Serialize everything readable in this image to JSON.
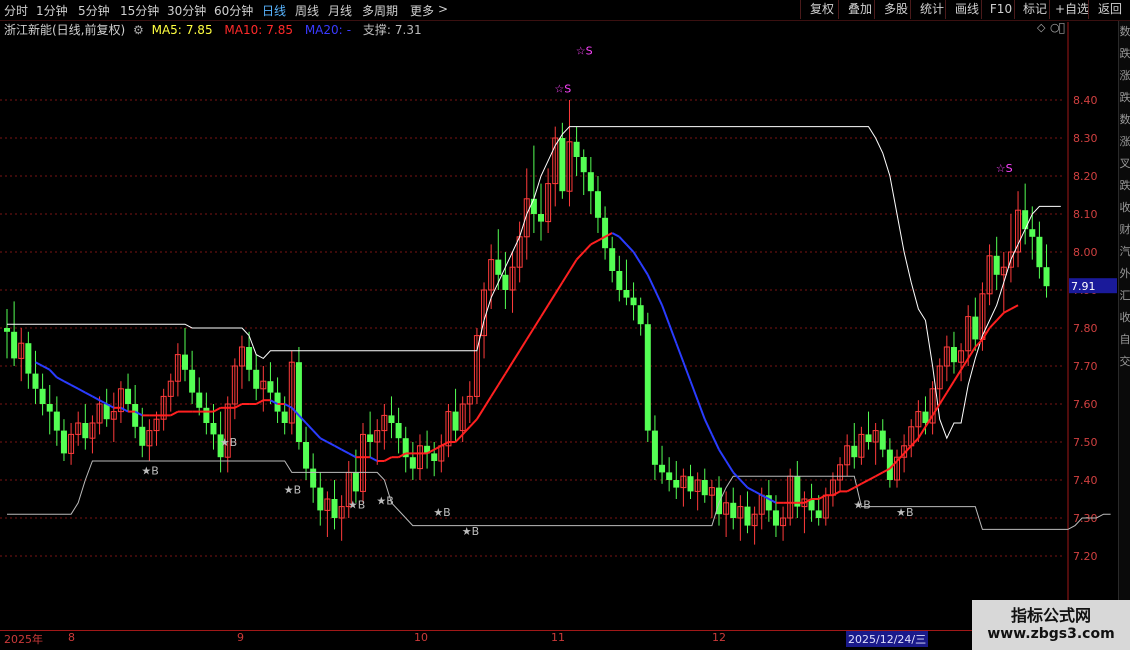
{
  "toolbar": {
    "periods": [
      "分时",
      "1分钟",
      "5分钟",
      "15分钟",
      "30分钟",
      "60分钟",
      "日线",
      "周线",
      "月线",
      "多周期",
      "更多"
    ],
    "active_period": "日线",
    "more_arrow": ">",
    "right_buttons": [
      "复权",
      "叠加",
      "多股",
      "统计",
      "画线",
      "F10",
      "标记",
      "+自选",
      "返回"
    ]
  },
  "info": {
    "stock_name": "浙江新能(日线,前复权)",
    "ma5_label": "MA5:",
    "ma5_value": "7.85",
    "ma10_label": "MA10:",
    "ma10_value": "7.85",
    "ma20_label": "MA20:",
    "ma20_value": "-",
    "support_label": "支撑:",
    "support_value": "7.31",
    "colors": {
      "ma5": "#ffff40",
      "ma10": "#ff2a2a",
      "ma20": "#3a3aff",
      "support": "#bbbbbb"
    }
  },
  "price_axis": {
    "ticks": [
      "8.40",
      "8.30",
      "8.20",
      "8.10",
      "8.00",
      "7.90",
      "7.80",
      "7.70",
      "7.60",
      "7.50",
      "7.40",
      "7.30",
      "7.20"
    ],
    "current_price": "7.91"
  },
  "date_axis": {
    "labels": [
      "2025年",
      "8",
      "9",
      "10",
      "11",
      "12"
    ],
    "cursor_date": "2025/12/24/三"
  },
  "watermark": {
    "line1": "指标公式网",
    "line2": "www.zbgs3.com"
  },
  "right_strip_chars": [
    "数",
    "跌",
    "涨",
    "跌",
    "数",
    "涨",
    "叉",
    "跌",
    "收",
    "财",
    "汽",
    "外",
    "汇",
    "收",
    "自",
    "交"
  ],
  "chart_data": {
    "type": "candlestick",
    "ylim": [
      7.15,
      8.58
    ],
    "signal_colors": {
      "buy": "#bdbdbd",
      "sell": "#ff44ff"
    },
    "candles": [
      [
        7.8,
        7.85,
        7.72,
        7.79
      ],
      [
        7.79,
        7.87,
        7.7,
        7.72
      ],
      [
        7.72,
        7.8,
        7.66,
        7.76
      ],
      [
        7.76,
        7.79,
        7.64,
        7.68
      ],
      [
        7.68,
        7.74,
        7.6,
        7.64
      ],
      [
        7.64,
        7.68,
        7.57,
        7.6
      ],
      [
        7.6,
        7.65,
        7.52,
        7.58
      ],
      [
        7.58,
        7.62,
        7.49,
        7.53
      ],
      [
        7.53,
        7.56,
        7.45,
        7.47
      ],
      [
        7.47,
        7.55,
        7.44,
        7.52
      ],
      [
        7.52,
        7.58,
        7.49,
        7.55
      ],
      [
        7.55,
        7.6,
        7.48,
        7.51
      ],
      [
        7.51,
        7.57,
        7.47,
        7.55
      ],
      [
        7.55,
        7.62,
        7.52,
        7.6
      ],
      [
        7.6,
        7.64,
        7.54,
        7.56
      ],
      [
        7.56,
        7.63,
        7.5,
        7.58
      ],
      [
        7.58,
        7.66,
        7.55,
        7.64
      ],
      [
        7.64,
        7.68,
        7.58,
        7.6
      ],
      [
        7.6,
        7.65,
        7.51,
        7.54
      ],
      [
        7.54,
        7.59,
        7.46,
        7.49
      ],
      [
        7.49,
        7.56,
        7.45,
        7.53
      ],
      [
        7.53,
        7.58,
        7.49,
        7.56
      ],
      [
        7.56,
        7.64,
        7.53,
        7.62
      ],
      [
        7.62,
        7.68,
        7.58,
        7.66
      ],
      [
        7.66,
        7.76,
        7.62,
        7.73
      ],
      [
        7.73,
        7.8,
        7.66,
        7.69
      ],
      [
        7.69,
        7.74,
        7.6,
        7.63
      ],
      [
        7.63,
        7.67,
        7.57,
        7.59
      ],
      [
        7.59,
        7.63,
        7.52,
        7.55
      ],
      [
        7.55,
        7.6,
        7.48,
        7.52
      ],
      [
        7.52,
        7.58,
        7.42,
        7.46
      ],
      [
        7.46,
        7.62,
        7.42,
        7.6
      ],
      [
        7.6,
        7.72,
        7.56,
        7.7
      ],
      [
        7.7,
        7.78,
        7.64,
        7.75
      ],
      [
        7.75,
        7.79,
        7.66,
        7.69
      ],
      [
        7.69,
        7.73,
        7.61,
        7.64
      ],
      [
        7.64,
        7.7,
        7.58,
        7.66
      ],
      [
        7.66,
        7.71,
        7.6,
        7.63
      ],
      [
        7.63,
        7.67,
        7.55,
        7.58
      ],
      [
        7.58,
        7.62,
        7.52,
        7.55
      ],
      [
        7.55,
        7.74,
        7.52,
        7.71
      ],
      [
        7.71,
        7.75,
        7.48,
        7.5
      ],
      [
        7.5,
        7.54,
        7.4,
        7.43
      ],
      [
        7.43,
        7.47,
        7.34,
        7.38
      ],
      [
        7.38,
        7.42,
        7.28,
        7.32
      ],
      [
        7.32,
        7.37,
        7.25,
        7.35
      ],
      [
        7.35,
        7.4,
        7.27,
        7.3
      ],
      [
        7.3,
        7.36,
        7.24,
        7.33
      ],
      [
        7.33,
        7.45,
        7.3,
        7.42
      ],
      [
        7.42,
        7.48,
        7.34,
        7.37
      ],
      [
        7.37,
        7.55,
        7.34,
        7.52
      ],
      [
        7.52,
        7.58,
        7.46,
        7.5
      ],
      [
        7.5,
        7.56,
        7.44,
        7.53
      ],
      [
        7.53,
        7.6,
        7.48,
        7.57
      ],
      [
        7.57,
        7.62,
        7.51,
        7.55
      ],
      [
        7.55,
        7.59,
        7.47,
        7.51
      ],
      [
        7.51,
        7.54,
        7.42,
        7.46
      ],
      [
        7.46,
        7.5,
        7.4,
        7.43
      ],
      [
        7.43,
        7.52,
        7.4,
        7.49
      ],
      [
        7.49,
        7.53,
        7.43,
        7.47
      ],
      [
        7.47,
        7.5,
        7.41,
        7.45
      ],
      [
        7.45,
        7.52,
        7.42,
        7.49
      ],
      [
        7.49,
        7.6,
        7.46,
        7.58
      ],
      [
        7.58,
        7.64,
        7.5,
        7.53
      ],
      [
        7.53,
        7.62,
        7.5,
        7.6
      ],
      [
        7.6,
        7.66,
        7.55,
        7.62
      ],
      [
        7.62,
        7.8,
        7.6,
        7.78
      ],
      [
        7.78,
        7.92,
        7.72,
        7.9
      ],
      [
        7.9,
        8.02,
        7.85,
        7.98
      ],
      [
        7.98,
        8.06,
        7.9,
        7.94
      ],
      [
        7.94,
        8.0,
        7.85,
        7.9
      ],
      [
        7.9,
        8.0,
        7.84,
        7.96
      ],
      [
        7.96,
        8.08,
        7.92,
        8.04
      ],
      [
        8.04,
        8.22,
        7.98,
        8.14
      ],
      [
        8.14,
        8.28,
        8.05,
        8.1
      ],
      [
        8.1,
        8.18,
        8.03,
        8.08
      ],
      [
        8.08,
        8.22,
        8.05,
        8.18
      ],
      [
        8.18,
        8.33,
        8.12,
        8.3
      ],
      [
        8.3,
        8.34,
        8.14,
        8.16
      ],
      [
        8.16,
        8.4,
        8.12,
        8.29
      ],
      [
        8.29,
        8.33,
        8.2,
        8.25
      ],
      [
        8.25,
        8.27,
        8.15,
        8.21
      ],
      [
        8.21,
        8.25,
        8.1,
        8.16
      ],
      [
        8.16,
        8.2,
        8.05,
        8.09
      ],
      [
        8.09,
        8.12,
        7.98,
        8.01
      ],
      [
        8.01,
        8.04,
        7.92,
        7.95
      ],
      [
        7.95,
        7.99,
        7.87,
        7.9
      ],
      [
        7.9,
        7.98,
        7.86,
        7.88
      ],
      [
        7.88,
        7.92,
        7.82,
        7.86
      ],
      [
        7.86,
        7.88,
        7.78,
        7.81
      ],
      [
        7.81,
        7.84,
        7.5,
        7.53
      ],
      [
        7.53,
        7.57,
        7.4,
        7.44
      ],
      [
        7.44,
        7.49,
        7.39,
        7.42
      ],
      [
        7.42,
        7.46,
        7.37,
        7.4
      ],
      [
        7.4,
        7.45,
        7.35,
        7.38
      ],
      [
        7.38,
        7.43,
        7.33,
        7.41
      ],
      [
        7.41,
        7.44,
        7.35,
        7.37
      ],
      [
        7.37,
        7.42,
        7.32,
        7.4
      ],
      [
        7.4,
        7.43,
        7.34,
        7.36
      ],
      [
        7.36,
        7.4,
        7.3,
        7.38
      ],
      [
        7.38,
        7.41,
        7.28,
        7.31
      ],
      [
        7.31,
        7.37,
        7.25,
        7.34
      ],
      [
        7.34,
        7.38,
        7.27,
        7.3
      ],
      [
        7.3,
        7.36,
        7.24,
        7.33
      ],
      [
        7.33,
        7.37,
        7.26,
        7.28
      ],
      [
        7.28,
        7.33,
        7.23,
        7.31
      ],
      [
        7.31,
        7.38,
        7.27,
        7.36
      ],
      [
        7.36,
        7.4,
        7.29,
        7.32
      ],
      [
        7.32,
        7.36,
        7.25,
        7.28
      ],
      [
        7.28,
        7.33,
        7.24,
        7.3
      ],
      [
        7.3,
        7.43,
        7.28,
        7.41
      ],
      [
        7.41,
        7.45,
        7.3,
        7.33
      ],
      [
        7.33,
        7.37,
        7.26,
        7.35
      ],
      [
        7.35,
        7.39,
        7.29,
        7.32
      ],
      [
        7.32,
        7.36,
        7.28,
        7.3
      ],
      [
        7.3,
        7.38,
        7.28,
        7.36
      ],
      [
        7.36,
        7.42,
        7.33,
        7.4
      ],
      [
        7.4,
        7.46,
        7.37,
        7.44
      ],
      [
        7.44,
        7.52,
        7.41,
        7.49
      ],
      [
        7.49,
        7.55,
        7.43,
        7.46
      ],
      [
        7.46,
        7.54,
        7.44,
        7.52
      ],
      [
        7.52,
        7.58,
        7.48,
        7.5
      ],
      [
        7.5,
        7.55,
        7.44,
        7.53
      ],
      [
        7.53,
        7.56,
        7.46,
        7.48
      ],
      [
        7.48,
        7.51,
        7.38,
        7.4
      ],
      [
        7.4,
        7.48,
        7.38,
        7.46
      ],
      [
        7.46,
        7.52,
        7.42,
        7.49
      ],
      [
        7.49,
        7.56,
        7.46,
        7.54
      ],
      [
        7.54,
        7.61,
        7.5,
        7.58
      ],
      [
        7.58,
        7.62,
        7.52,
        7.55
      ],
      [
        7.55,
        7.66,
        7.52,
        7.64
      ],
      [
        7.64,
        7.72,
        7.6,
        7.7
      ],
      [
        7.7,
        7.78,
        7.66,
        7.75
      ],
      [
        7.75,
        7.79,
        7.68,
        7.71
      ],
      [
        7.71,
        7.76,
        7.66,
        7.74
      ],
      [
        7.74,
        7.86,
        7.7,
        7.83
      ],
      [
        7.83,
        7.88,
        7.74,
        7.77
      ],
      [
        7.77,
        7.92,
        7.74,
        7.89
      ],
      [
        7.89,
        8.02,
        7.86,
        7.99
      ],
      [
        7.99,
        8.04,
        7.9,
        7.94
      ],
      [
        7.94,
        8.0,
        7.84,
        7.96
      ],
      [
        7.96,
        8.1,
        7.92,
        8.0
      ],
      [
        8.0,
        8.16,
        7.96,
        8.11
      ],
      [
        8.11,
        8.18,
        8.02,
        8.06
      ],
      [
        8.06,
        8.12,
        7.98,
        8.04
      ],
      [
        8.04,
        8.08,
        7.93,
        7.96
      ],
      [
        7.96,
        8.02,
        7.88,
        7.91
      ]
    ],
    "ma20": [
      null,
      null,
      null,
      null,
      7.71,
      7.7,
      7.69,
      7.67,
      7.66,
      7.65,
      7.64,
      7.63,
      7.62,
      7.61,
      7.6,
      7.59,
      7.59,
      7.58,
      7.58,
      7.57,
      7.57,
      7.57,
      7.57,
      7.57,
      7.58,
      7.58,
      7.58,
      7.58,
      7.58,
      7.58,
      7.59,
      7.59,
      7.59,
      7.6,
      7.6,
      7.6,
      7.61,
      7.61,
      7.6,
      7.6,
      7.59,
      7.57,
      7.55,
      7.53,
      7.51,
      7.5,
      7.49,
      7.48,
      7.47,
      7.46,
      7.46,
      7.46,
      7.45,
      7.45,
      7.46,
      7.46,
      7.47,
      7.47,
      7.47,
      7.47,
      7.48,
      7.49,
      7.5,
      7.5,
      7.52,
      7.54,
      7.56,
      7.59,
      7.62,
      7.65,
      7.68,
      7.71,
      7.74,
      7.77,
      7.8,
      7.83,
      7.86,
      7.89,
      7.92,
      7.95,
      7.98,
      8.0,
      8.02,
      8.03,
      8.04,
      8.05,
      8.04,
      8.02,
      8.0,
      7.97,
      7.94,
      7.9,
      7.86,
      7.81,
      7.76,
      7.71,
      7.66,
      7.61,
      7.56,
      7.52,
      7.48,
      7.45,
      7.42,
      7.4,
      7.38,
      7.37,
      7.36,
      7.35,
      7.34,
      7.34,
      7.34,
      7.34,
      7.34,
      7.35,
      7.35,
      7.36,
      7.36,
      7.37,
      7.37,
      7.38,
      7.39,
      7.4,
      7.41,
      7.42,
      7.43,
      7.45,
      7.47,
      7.49,
      7.51,
      7.54,
      7.57,
      7.6,
      7.63,
      7.66,
      7.69,
      7.72,
      7.75,
      7.77,
      7.8,
      7.82,
      7.84,
      7.85,
      7.86
    ],
    "upper_band": [
      7.81,
      7.81,
      7.81,
      7.81,
      7.81,
      7.81,
      7.81,
      7.81,
      7.81,
      7.81,
      7.81,
      7.81,
      7.81,
      7.81,
      7.81,
      7.81,
      7.81,
      7.81,
      7.81,
      7.81,
      7.81,
      7.81,
      7.81,
      7.81,
      7.81,
      7.81,
      7.8,
      7.8,
      7.8,
      7.8,
      7.8,
      7.8,
      7.8,
      7.8,
      7.78,
      7.73,
      7.72,
      7.74,
      7.74,
      7.74,
      7.74,
      7.74,
      7.74,
      7.74,
      7.74,
      7.74,
      7.74,
      7.74,
      7.74,
      7.74,
      7.74,
      7.74,
      7.74,
      7.74,
      7.74,
      7.74,
      7.74,
      7.74,
      7.74,
      7.74,
      7.74,
      7.74,
      7.74,
      7.74,
      7.74,
      7.74,
      7.74,
      7.82,
      7.88,
      7.92,
      7.96,
      8.0,
      8.04,
      8.1,
      8.14,
      8.2,
      8.24,
      8.28,
      8.31,
      8.33,
      8.33,
      8.33,
      8.33,
      8.33,
      8.33,
      8.33,
      8.33,
      8.33,
      8.33,
      8.33,
      8.33,
      8.33,
      8.33,
      8.33,
      8.33,
      8.33,
      8.33,
      8.33,
      8.33,
      8.33,
      8.33,
      8.33,
      8.33,
      8.33,
      8.33,
      8.33,
      8.33,
      8.33,
      8.33,
      8.33,
      8.33,
      8.33,
      8.33,
      8.33,
      8.33,
      8.33,
      8.33,
      8.33,
      8.33,
      8.33,
      8.33,
      8.33,
      8.3,
      8.26,
      8.2,
      8.1,
      8.0,
      7.92,
      7.85,
      7.82,
      7.7,
      7.56,
      7.51,
      7.55,
      7.55,
      7.65,
      7.72,
      7.78,
      7.82,
      7.86,
      7.92,
      7.98,
      8.02,
      8.06,
      8.1,
      8.12,
      8.12,
      8.12,
      8.12
    ],
    "support": [
      7.31,
      7.31,
      7.31,
      7.31,
      7.31,
      7.31,
      7.31,
      7.31,
      7.31,
      7.31,
      7.34,
      7.4,
      7.45,
      7.45,
      7.45,
      7.45,
      7.45,
      7.45,
      7.45,
      7.45,
      7.45,
      7.45,
      7.45,
      7.45,
      7.45,
      7.45,
      7.45,
      7.45,
      7.45,
      7.45,
      7.45,
      7.45,
      7.45,
      7.45,
      7.45,
      7.45,
      7.45,
      7.45,
      7.45,
      7.45,
      7.42,
      7.42,
      7.42,
      7.42,
      7.42,
      7.42,
      7.42,
      7.42,
      7.42,
      7.42,
      7.42,
      7.42,
      7.42,
      7.4,
      7.34,
      7.32,
      7.3,
      7.28,
      7.28,
      7.28,
      7.28,
      7.28,
      7.28,
      7.28,
      7.28,
      7.28,
      7.28,
      7.28,
      7.28,
      7.28,
      7.28,
      7.28,
      7.28,
      7.28,
      7.28,
      7.28,
      7.28,
      7.28,
      7.28,
      7.28,
      7.28,
      7.28,
      7.28,
      7.28,
      7.28,
      7.28,
      7.28,
      7.28,
      7.28,
      7.28,
      7.28,
      7.28,
      7.28,
      7.28,
      7.28,
      7.28,
      7.28,
      7.28,
      7.28,
      7.28,
      7.34,
      7.38,
      7.41,
      7.41,
      7.41,
      7.41,
      7.41,
      7.41,
      7.41,
      7.41,
      7.41,
      7.41,
      7.41,
      7.41,
      7.41,
      7.41,
      7.41,
      7.41,
      7.41,
      7.41,
      7.33,
      7.33,
      7.33,
      7.33,
      7.33,
      7.33,
      7.33,
      7.33,
      7.33,
      7.33,
      7.33,
      7.33,
      7.33,
      7.33,
      7.33,
      7.33,
      7.33,
      7.27,
      7.27,
      7.27,
      7.27,
      7.27,
      7.27,
      7.27,
      7.27,
      7.27,
      7.27,
      7.27,
      7.27,
      7.27,
      7.28,
      7.3,
      7.3,
      7.3,
      7.31,
      7.31
    ],
    "buy_signals": [
      {
        "i": 20,
        "price": 7.415,
        "label": "★B"
      },
      {
        "i": 31,
        "price": 7.49,
        "label": "★B"
      },
      {
        "i": 40,
        "price": 7.365,
        "label": "★B"
      },
      {
        "i": 49,
        "price": 7.325,
        "label": "★B"
      },
      {
        "i": 53,
        "price": 7.335,
        "label": "★B"
      },
      {
        "i": 61,
        "price": 7.305,
        "label": "★B"
      },
      {
        "i": 65,
        "price": 7.255,
        "label": "★B"
      },
      {
        "i": 120,
        "price": 7.325,
        "label": "★B"
      },
      {
        "i": 126,
        "price": 7.305,
        "label": "★B"
      }
    ],
    "sell_signals": [
      {
        "i": 78,
        "price": 8.42,
        "label": "☆S"
      },
      {
        "i": 81,
        "price": 8.52,
        "label": "☆S"
      },
      {
        "i": 140,
        "price": 8.21,
        "label": "☆S"
      }
    ]
  }
}
